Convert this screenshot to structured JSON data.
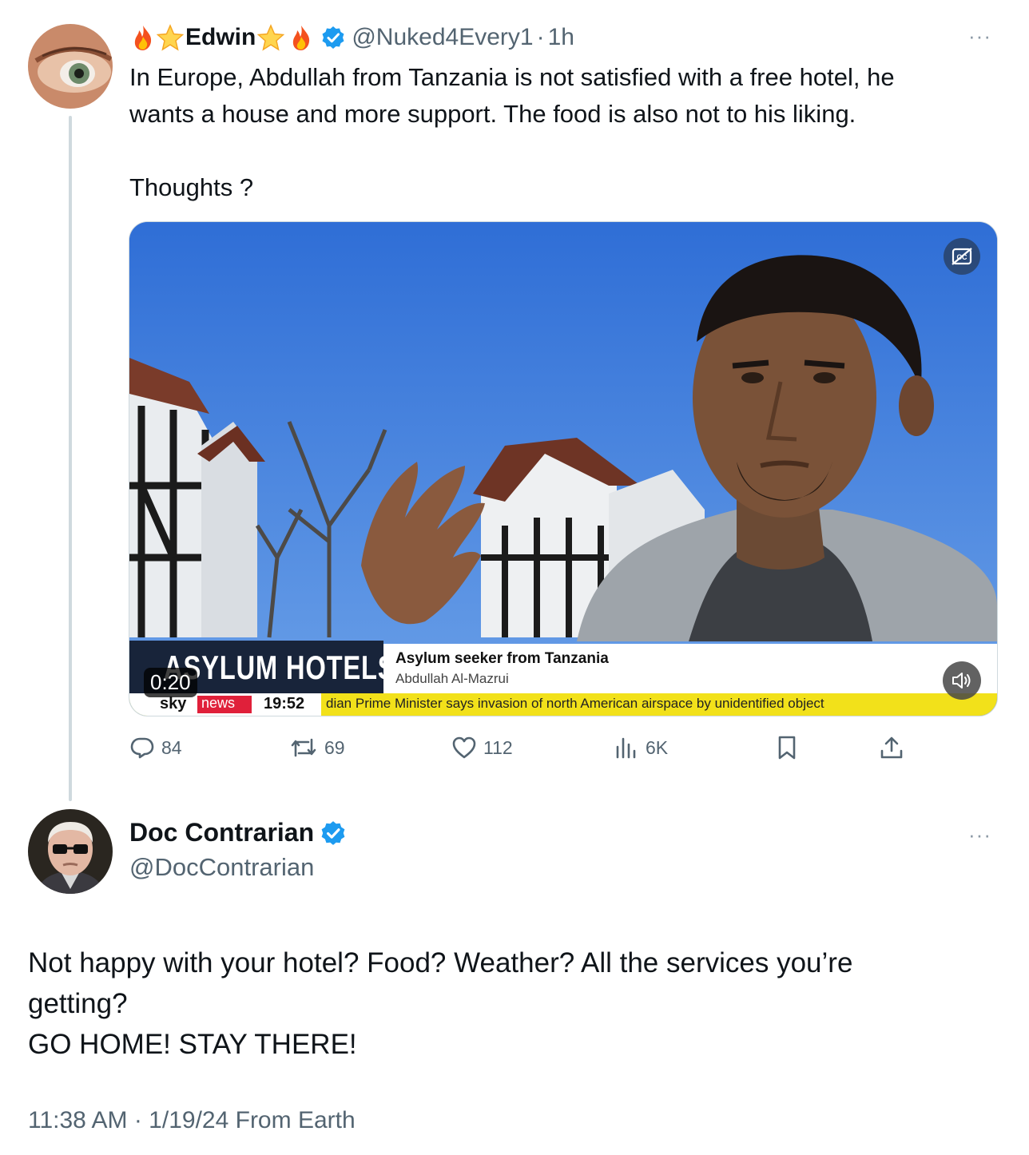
{
  "tweet1": {
    "display_name": "Edwin",
    "handle": "@Nuked4Every1",
    "separator": "·",
    "time": "1h",
    "more": "···",
    "text_line1": "In Europe, Abdullah from Tanzania is not satisfied with a free hotel, he",
    "text_line2": "wants a house and more support. The food is also not to his liking.",
    "text_line3": "Thoughts ?",
    "video": {
      "duration": "0:20",
      "lower_third_title": "ASYLUM HOTELS",
      "caption_line1": "Asylum seeker from Tanzania",
      "caption_line2": "Abdullah Al-Mazrui",
      "channel": "sky",
      "channel_badge": "news",
      "clock": "19:52",
      "ticker": "dian Prime Minister says invasion of north American airspace by unidentified object"
    },
    "stats": {
      "replies": "84",
      "reposts": "69",
      "likes": "112",
      "views": "6K"
    }
  },
  "tweet2": {
    "display_name": "Doc Contrarian",
    "handle": "@DocContrarian",
    "more": "···",
    "text_line1": "Not happy with your hotel? Food? Weather? All the services you’re",
    "text_line2": "getting?",
    "text_line3": "GO HOME! STAY THERE!",
    "footer": "11:38 AM · 1/19/24 From Earth"
  },
  "colors": {
    "verified": "#1d9bf0",
    "secondary_text": "#536471",
    "thread_line": "#cfd9de",
    "ticker_yellow": "#f2e11a"
  }
}
